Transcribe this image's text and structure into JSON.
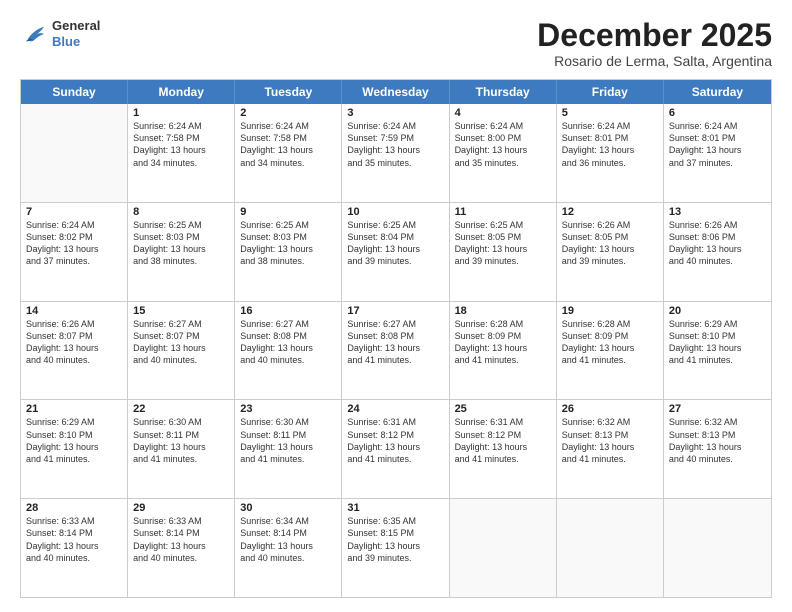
{
  "header": {
    "logo_line1": "General",
    "logo_line2": "Blue",
    "month": "December 2025",
    "location": "Rosario de Lerma, Salta, Argentina"
  },
  "weekdays": [
    "Sunday",
    "Monday",
    "Tuesday",
    "Wednesday",
    "Thursday",
    "Friday",
    "Saturday"
  ],
  "weeks": [
    [
      {
        "day": "",
        "sunrise": "",
        "sunset": "",
        "daylight": ""
      },
      {
        "day": "1",
        "sunrise": "Sunrise: 6:24 AM",
        "sunset": "Sunset: 7:58 PM",
        "daylight": "Daylight: 13 hours and 34 minutes."
      },
      {
        "day": "2",
        "sunrise": "Sunrise: 6:24 AM",
        "sunset": "Sunset: 7:58 PM",
        "daylight": "Daylight: 13 hours and 34 minutes."
      },
      {
        "day": "3",
        "sunrise": "Sunrise: 6:24 AM",
        "sunset": "Sunset: 7:59 PM",
        "daylight": "Daylight: 13 hours and 35 minutes."
      },
      {
        "day": "4",
        "sunrise": "Sunrise: 6:24 AM",
        "sunset": "Sunset: 8:00 PM",
        "daylight": "Daylight: 13 hours and 35 minutes."
      },
      {
        "day": "5",
        "sunrise": "Sunrise: 6:24 AM",
        "sunset": "Sunset: 8:01 PM",
        "daylight": "Daylight: 13 hours and 36 minutes."
      },
      {
        "day": "6",
        "sunrise": "Sunrise: 6:24 AM",
        "sunset": "Sunset: 8:01 PM",
        "daylight": "Daylight: 13 hours and 37 minutes."
      }
    ],
    [
      {
        "day": "7",
        "sunrise": "Sunrise: 6:24 AM",
        "sunset": "Sunset: 8:02 PM",
        "daylight": "Daylight: 13 hours and 37 minutes."
      },
      {
        "day": "8",
        "sunrise": "Sunrise: 6:25 AM",
        "sunset": "Sunset: 8:03 PM",
        "daylight": "Daylight: 13 hours and 38 minutes."
      },
      {
        "day": "9",
        "sunrise": "Sunrise: 6:25 AM",
        "sunset": "Sunset: 8:03 PM",
        "daylight": "Daylight: 13 hours and 38 minutes."
      },
      {
        "day": "10",
        "sunrise": "Sunrise: 6:25 AM",
        "sunset": "Sunset: 8:04 PM",
        "daylight": "Daylight: 13 hours and 39 minutes."
      },
      {
        "day": "11",
        "sunrise": "Sunrise: 6:25 AM",
        "sunset": "Sunset: 8:05 PM",
        "daylight": "Daylight: 13 hours and 39 minutes."
      },
      {
        "day": "12",
        "sunrise": "Sunrise: 6:26 AM",
        "sunset": "Sunset: 8:05 PM",
        "daylight": "Daylight: 13 hours and 39 minutes."
      },
      {
        "day": "13",
        "sunrise": "Sunrise: 6:26 AM",
        "sunset": "Sunset: 8:06 PM",
        "daylight": "Daylight: 13 hours and 40 minutes."
      }
    ],
    [
      {
        "day": "14",
        "sunrise": "Sunrise: 6:26 AM",
        "sunset": "Sunset: 8:07 PM",
        "daylight": "Daylight: 13 hours and 40 minutes."
      },
      {
        "day": "15",
        "sunrise": "Sunrise: 6:27 AM",
        "sunset": "Sunset: 8:07 PM",
        "daylight": "Daylight: 13 hours and 40 minutes."
      },
      {
        "day": "16",
        "sunrise": "Sunrise: 6:27 AM",
        "sunset": "Sunset: 8:08 PM",
        "daylight": "Daylight: 13 hours and 40 minutes."
      },
      {
        "day": "17",
        "sunrise": "Sunrise: 6:27 AM",
        "sunset": "Sunset: 8:08 PM",
        "daylight": "Daylight: 13 hours and 41 minutes."
      },
      {
        "day": "18",
        "sunrise": "Sunrise: 6:28 AM",
        "sunset": "Sunset: 8:09 PM",
        "daylight": "Daylight: 13 hours and 41 minutes."
      },
      {
        "day": "19",
        "sunrise": "Sunrise: 6:28 AM",
        "sunset": "Sunset: 8:09 PM",
        "daylight": "Daylight: 13 hours and 41 minutes."
      },
      {
        "day": "20",
        "sunrise": "Sunrise: 6:29 AM",
        "sunset": "Sunset: 8:10 PM",
        "daylight": "Daylight: 13 hours and 41 minutes."
      }
    ],
    [
      {
        "day": "21",
        "sunrise": "Sunrise: 6:29 AM",
        "sunset": "Sunset: 8:10 PM",
        "daylight": "Daylight: 13 hours and 41 minutes."
      },
      {
        "day": "22",
        "sunrise": "Sunrise: 6:30 AM",
        "sunset": "Sunset: 8:11 PM",
        "daylight": "Daylight: 13 hours and 41 minutes."
      },
      {
        "day": "23",
        "sunrise": "Sunrise: 6:30 AM",
        "sunset": "Sunset: 8:11 PM",
        "daylight": "Daylight: 13 hours and 41 minutes."
      },
      {
        "day": "24",
        "sunrise": "Sunrise: 6:31 AM",
        "sunset": "Sunset: 8:12 PM",
        "daylight": "Daylight: 13 hours and 41 minutes."
      },
      {
        "day": "25",
        "sunrise": "Sunrise: 6:31 AM",
        "sunset": "Sunset: 8:12 PM",
        "daylight": "Daylight: 13 hours and 41 minutes."
      },
      {
        "day": "26",
        "sunrise": "Sunrise: 6:32 AM",
        "sunset": "Sunset: 8:13 PM",
        "daylight": "Daylight: 13 hours and 41 minutes."
      },
      {
        "day": "27",
        "sunrise": "Sunrise: 6:32 AM",
        "sunset": "Sunset: 8:13 PM",
        "daylight": "Daylight: 13 hours and 40 minutes."
      }
    ],
    [
      {
        "day": "28",
        "sunrise": "Sunrise: 6:33 AM",
        "sunset": "Sunset: 8:14 PM",
        "daylight": "Daylight: 13 hours and 40 minutes."
      },
      {
        "day": "29",
        "sunrise": "Sunrise: 6:33 AM",
        "sunset": "Sunset: 8:14 PM",
        "daylight": "Daylight: 13 hours and 40 minutes."
      },
      {
        "day": "30",
        "sunrise": "Sunrise: 6:34 AM",
        "sunset": "Sunset: 8:14 PM",
        "daylight": "Daylight: 13 hours and 40 minutes."
      },
      {
        "day": "31",
        "sunrise": "Sunrise: 6:35 AM",
        "sunset": "Sunset: 8:15 PM",
        "daylight": "Daylight: 13 hours and 39 minutes."
      },
      {
        "day": "",
        "sunrise": "",
        "sunset": "",
        "daylight": ""
      },
      {
        "day": "",
        "sunrise": "",
        "sunset": "",
        "daylight": ""
      },
      {
        "day": "",
        "sunrise": "",
        "sunset": "",
        "daylight": ""
      }
    ]
  ]
}
